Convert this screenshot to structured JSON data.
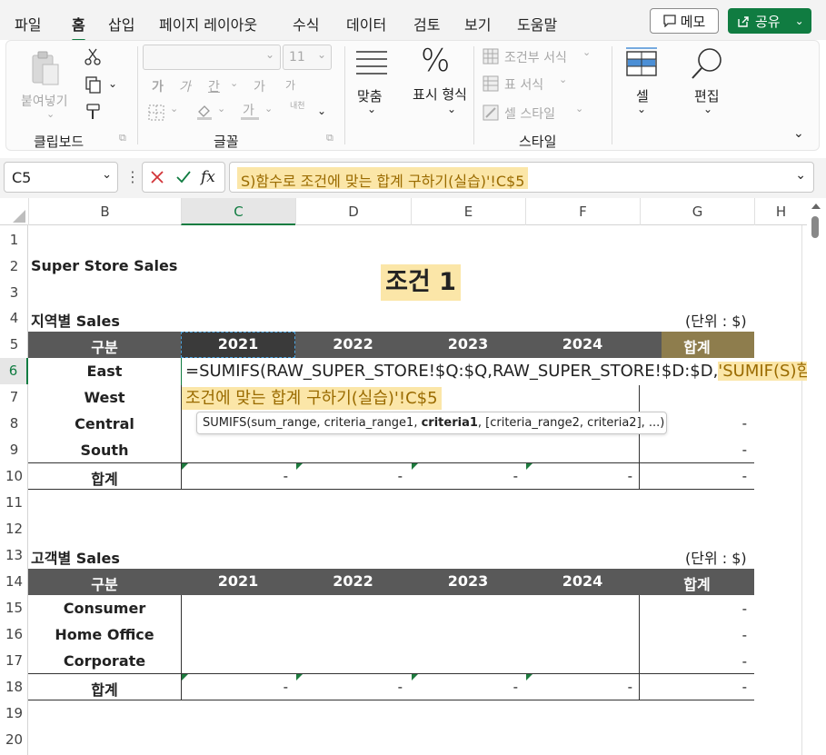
{
  "menubar": {
    "tabs": [
      "파일",
      "홈",
      "삽입",
      "페이지 레이아웃",
      "수식",
      "데이터",
      "검토",
      "보기",
      "도움말"
    ],
    "active_tab": "홈",
    "memo_label": "메모",
    "share_label": "공유",
    "accent_color": "#107c41"
  },
  "ribbon": {
    "clipboard": {
      "paste_label": "붙여넣기",
      "group_label": "클립보드"
    },
    "font": {
      "font_name": "",
      "font_size": "11",
      "group_label": "글꼴",
      "phonetic_label": "내천",
      "bold_glyph": "가",
      "italic_glyph": "가",
      "underline_glyph": "간",
      "grow_glyph": "가",
      "shrink_glyph": "가",
      "font_color_glyph": "가"
    },
    "alignment": {
      "label": "맞춤"
    },
    "number": {
      "label": "표시 형식",
      "symbol": "%"
    },
    "styles": {
      "conditional": "조건부 서식",
      "table": "표 서식",
      "cell_style": "셀 스타일",
      "group_label": "스타일"
    },
    "cells": {
      "label": "셀"
    },
    "editing": {
      "label": "편집"
    }
  },
  "formula_bar": {
    "name_box": "C5",
    "fx_label": "fx",
    "formula_visible": "S)함수로 조건에 맞는 합계 구하기(실습)'!C$5"
  },
  "columns": [
    "B",
    "C",
    "D",
    "E",
    "F",
    "G",
    "H"
  ],
  "selected_column": "C",
  "rows": [
    "1",
    "2",
    "3",
    "4",
    "5",
    "6",
    "7",
    "8",
    "9",
    "10",
    "11",
    "12",
    "13",
    "14",
    "15",
    "16",
    "17",
    "18",
    "19",
    "20"
  ],
  "selected_row": "6",
  "sheet": {
    "store_title": "Super Store Sales",
    "condition_title": "조건 1",
    "region": {
      "heading": "지역별 Sales",
      "unit": "(단위 : $)",
      "header": [
        "구분",
        "2021",
        "2022",
        "2023",
        "2024",
        "합계"
      ],
      "rows": [
        "East",
        "West",
        "Central",
        "South"
      ],
      "total_label": "합계",
      "total_dashes": [
        "-",
        "-",
        "-",
        "-",
        "-"
      ],
      "g_dashes": [
        "-",
        "-"
      ]
    },
    "customer": {
      "heading": "고객별 Sales",
      "unit": "(단위 : $)",
      "header": [
        "구분",
        "2021",
        "2022",
        "2023",
        "2024",
        "합계"
      ],
      "rows": [
        "Consumer",
        "Home Office",
        "Corporate"
      ],
      "total_label": "합계",
      "g_dashes": [
        "-",
        "-",
        "-"
      ],
      "total_dashes": [
        "-",
        "-",
        "-",
        "-",
        "-"
      ]
    }
  },
  "edit": {
    "formula_line1": "=SUMIFS(RAW_SUPER_STORE!$Q:$Q,RAW_SUPER_STORE!$D:$D,",
    "formula_ref1": "'SUMIF(S)함수로",
    "formula_line2": "조건에 맞는 합계 구하기(실습)'!C$5",
    "tooltip_pre": "SUMIFS(sum_range, criteria_range1, ",
    "tooltip_bold": "criteria1",
    "tooltip_post": ", [criteria_range2, criteria2], ...)"
  }
}
